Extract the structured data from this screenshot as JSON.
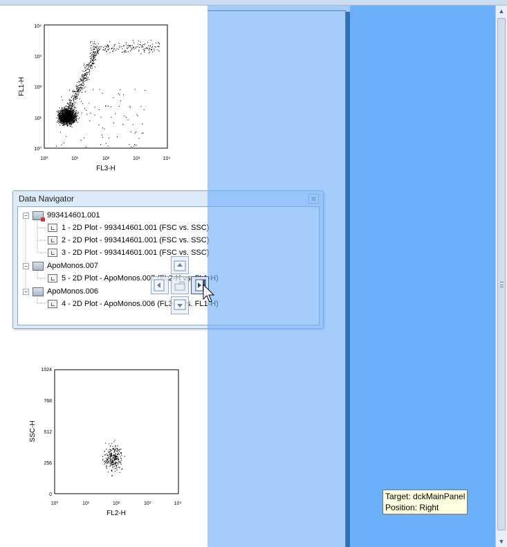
{
  "plot_top": {
    "x_axis_label": "FL3-H",
    "y_axis_label": "FL1-H",
    "x_ticks": [
      "10⁰",
      "10¹",
      "10²",
      "10³",
      "10⁴"
    ],
    "y_ticks": [
      "10⁰",
      "10¹",
      "10²",
      "10³",
      "10⁴"
    ]
  },
  "plot_bottom": {
    "x_axis_label": "FL2-H",
    "y_axis_label": "SSC-H",
    "x_ticks": [
      "10⁰",
      "10¹",
      "10²",
      "10³",
      "10⁴"
    ],
    "y_ticks": [
      "0",
      "256",
      "512",
      "768",
      "1024"
    ]
  },
  "data_navigator": {
    "title": "Data Navigator",
    "close_symbol": "⊠",
    "tree": [
      {
        "label": "993414601.001",
        "expanded_symbol": "−",
        "children": [
          "1 - 2D Plot - 993414601.001 (FSC vs. SSC)",
          "2 - 2D Plot - 993414601.001 (FSC vs. SSC)",
          "3 - 2D Plot - 993414601.001 (FSC vs. SSC)"
        ]
      },
      {
        "label": "ApoMonos.007",
        "expanded_symbol": "−",
        "children": [
          "5 - 2D Plot - ApoMonos.007 (FL2-H vs. FL1-H)"
        ]
      },
      {
        "label": "ApoMonos.006",
        "expanded_symbol": "−",
        "children": [
          "4 - 2D Plot - ApoMonos.006 (FL3-H vs. FL1-H)"
        ]
      }
    ]
  },
  "dock_tooltip": {
    "target": "Target: dckMainPanel",
    "position": "Position: Right"
  },
  "scrollbar": {
    "up_symbol": "▲",
    "down_symbol": "▼"
  },
  "colors": {
    "dock_preview": "#6eaffa",
    "panel_edge": "#2f6fb8",
    "tooltip_bg": "#ffffe1",
    "window_bg": "#ddeaf8"
  }
}
